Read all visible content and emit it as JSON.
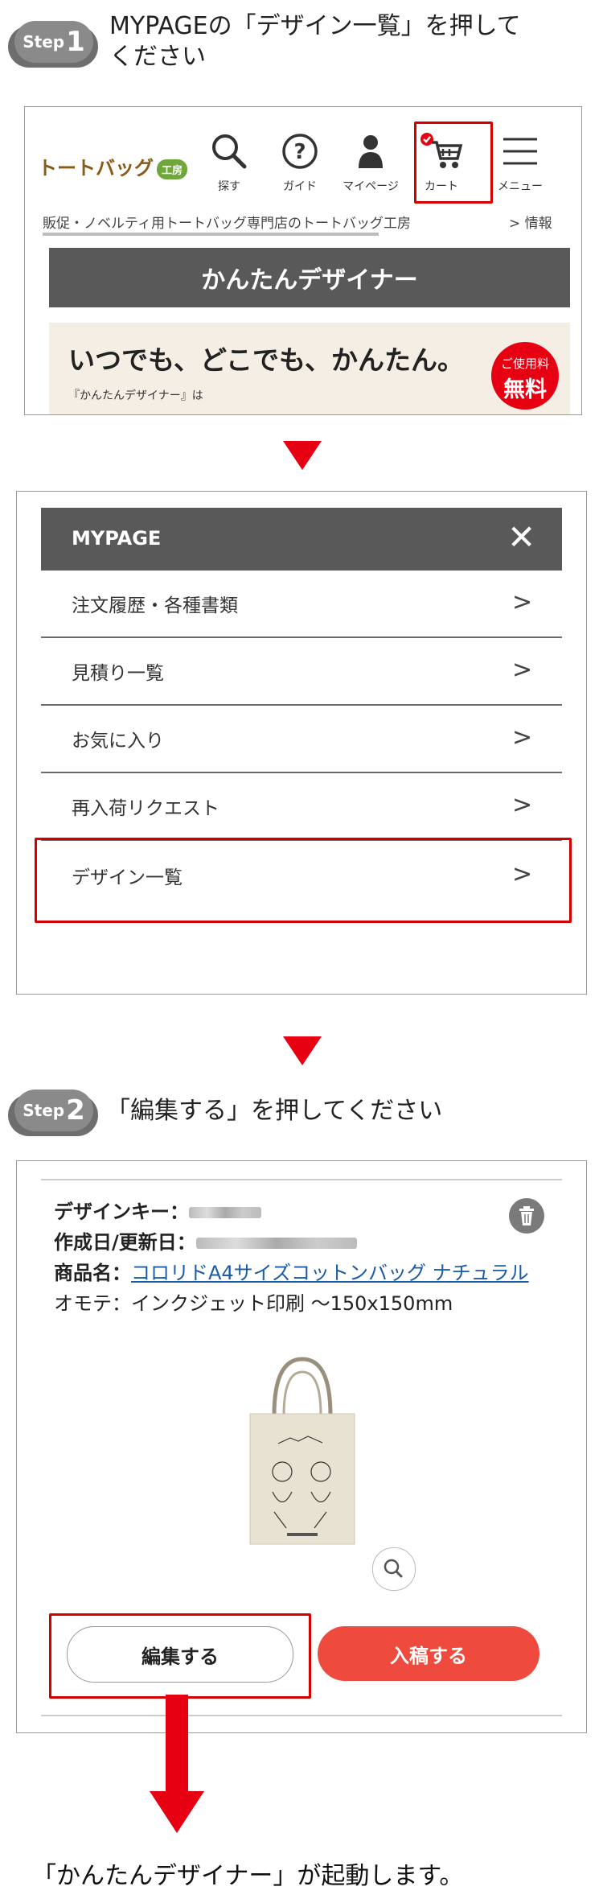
{
  "step1": {
    "badge_word": "Step",
    "badge_num": "1",
    "text_line1": "MYPAGEの「デザイン一覧」を押して",
    "text_line2": "ください"
  },
  "header": {
    "logo_text": "トートバッグ",
    "logo_badge": "工房",
    "nav": [
      {
        "label": "探す",
        "icon": "search-icon"
      },
      {
        "label": "ガイド",
        "icon": "help-icon"
      },
      {
        "label": "マイページ",
        "icon": "user-icon"
      },
      {
        "label": "カート",
        "icon": "cart-icon"
      },
      {
        "label": "メニュー",
        "icon": "hamburger-icon"
      }
    ],
    "breadcrumb": "販促・ノベルティ用トートバッグ専門店のトートバッグ工房",
    "breadcrumb_more": "> 情報"
  },
  "page_title": "かんたんデザイナー",
  "promo": {
    "headline": "いつでも、どこでも、かんたん。",
    "subtext": "『かんたんデザイナー』は",
    "free_line1": "ご使用料",
    "free_line2": "無料"
  },
  "menu": {
    "title": "MYPAGE",
    "close": "✕",
    "items": [
      {
        "label": "注文履歴・各種書類"
      },
      {
        "label": "見積り一覧"
      },
      {
        "label": "お気に入り"
      },
      {
        "label": "再入荷リクエスト"
      },
      {
        "label": "デザイン一覧"
      }
    ],
    "chevron": ">"
  },
  "step2": {
    "badge_word": "Step",
    "badge_num": "2",
    "text": "「編集する」を押してください"
  },
  "card": {
    "design_key_label": "デザインキー：",
    "date_label": "作成日/更新日：",
    "product_label": "商品名：",
    "product_name": "コロリドA4サイズコットンバッグ ナチュラル",
    "print_line": "オモテ：インクジェット印刷 ～150x150mm",
    "edit_button": "編集する",
    "submit_button": "入稿する"
  },
  "final_text": "「かんたんデザイナー」が起動します。",
  "colors": {
    "accent_red": "#e60012",
    "button_red": "#ee4a3d",
    "header_gray": "#595959",
    "link_blue": "#1b5ba8"
  }
}
